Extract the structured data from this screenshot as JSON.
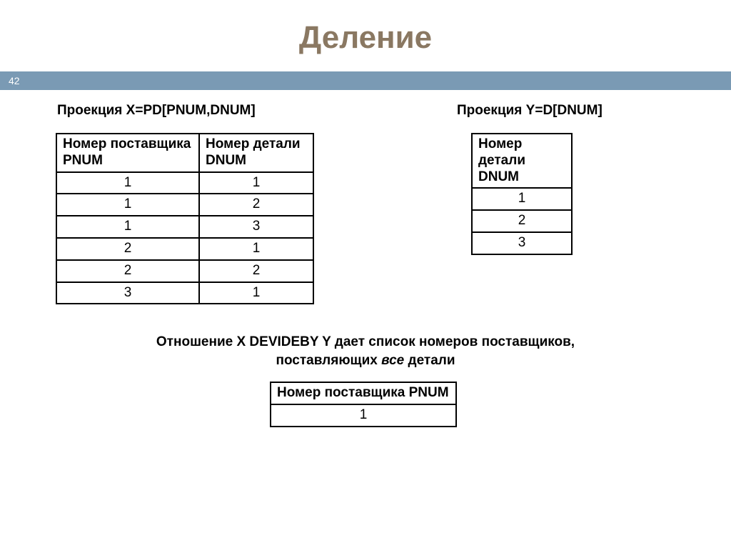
{
  "page_number": "42",
  "title": "Деление",
  "caption_x": "Проекция X=PD[PNUM,DNUM]",
  "caption_y": "Проекция Y=D[DNUM]",
  "table_x": {
    "h1": "Номер поставщика PNUM",
    "h2": "Номер детали DNUM",
    "rows": [
      {
        "c1": "1",
        "c2": "1"
      },
      {
        "c1": "1",
        "c2": "2"
      },
      {
        "c1": "1",
        "c2": "3"
      },
      {
        "c1": "2",
        "c2": "1"
      },
      {
        "c1": "2",
        "c2": "2"
      },
      {
        "c1": "3",
        "c2": "1"
      }
    ]
  },
  "table_y": {
    "h1": "Номер детали DNUM",
    "rows": [
      {
        "c1": "1"
      },
      {
        "c1": "2"
      },
      {
        "c1": "3"
      }
    ]
  },
  "description": {
    "line1": "Отношение X DEVIDEBY Y дает список номеров поставщиков,",
    "line2a": "поставляющих ",
    "line2b": "все",
    "line2c": " детали"
  },
  "table_r": {
    "h1": "Номер поставщика PNUM",
    "rows": [
      {
        "c1": "1"
      }
    ]
  }
}
